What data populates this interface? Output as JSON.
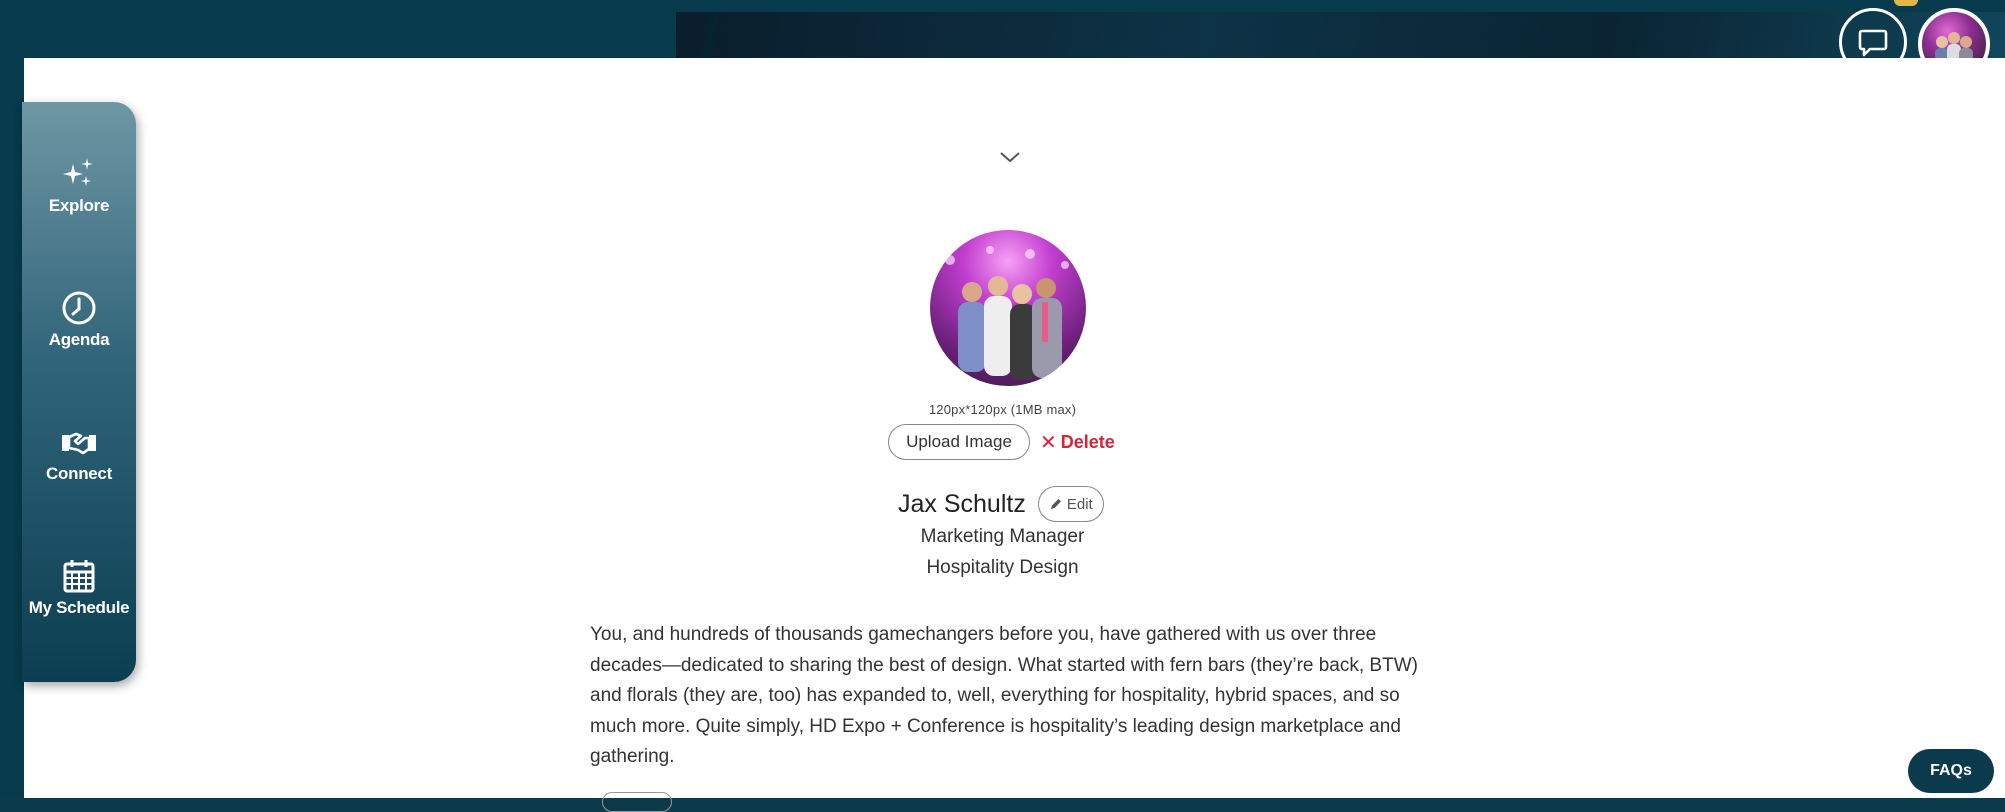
{
  "sidebar": {
    "items": [
      {
        "label": "Explore",
        "icon": "sparkles-icon"
      },
      {
        "label": "Agenda",
        "icon": "clock-icon"
      },
      {
        "label": "Connect",
        "icon": "handshake-icon"
      },
      {
        "label": "My Schedule",
        "icon": "calendar-icon"
      }
    ]
  },
  "header": {
    "chat_icon": "chat-bubble-icon",
    "avatar_icon": "user-avatar"
  },
  "profile": {
    "image_hint": "120px*120px (1MB max)",
    "upload_label": "Upload Image",
    "delete_label": "Delete",
    "name": "Jax Schultz",
    "edit_label": "Edit",
    "job_title": "Marketing Manager",
    "company": "Hospitality Design",
    "bio": "You, and hundreds of thousands gamechangers before you, have gathered with us over three decades—dedicated to sharing the best of design. What started with fern bars (they’re back, BTW) and florals (they are, too) has expanded to, well, everything for hospitality, hybrid spaces, and so much more. Quite simply, HD Expo + Conference is hospitality’s leading design marketplace and gathering."
  },
  "faqs_label": "FAQs",
  "colors": {
    "brand_dark": "#063a4c",
    "delete_red": "#d6243a",
    "sidebar_top": "#6f97a4",
    "sidebar_bottom": "#0c3e51"
  }
}
